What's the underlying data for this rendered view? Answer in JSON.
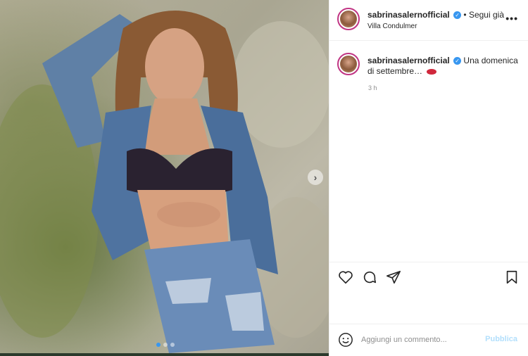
{
  "post": {
    "username": "sabrinasalernofficial",
    "verified_icon": "verified-check-icon",
    "follow_status": "Segui già",
    "location": "Villa Condulmer",
    "more_icon": "more-dots-icon",
    "more_label": "•••"
  },
  "caption": {
    "username": "sabrinasalernofficial",
    "text": "Una domenica di settembre…",
    "emoji_icon": "lips-emoji-icon",
    "time": "3 h"
  },
  "actions": {
    "like_icon": "heart-icon",
    "comment_icon": "comment-bubble-icon",
    "share_icon": "paper-plane-icon",
    "save_icon": "bookmark-icon"
  },
  "comment": {
    "placeholder": "Aggiungi un commento...",
    "publish_label": "Pubblica",
    "emoji_icon": "smiley-icon"
  },
  "carousel": {
    "next_label": "›",
    "total_slides": 3,
    "active_slide": 1
  },
  "colors": {
    "accent": "#3897f0",
    "publish_disabled": "#b2dffc",
    "text": "#262626",
    "muted": "#8e8e8e",
    "border": "#efefef"
  }
}
